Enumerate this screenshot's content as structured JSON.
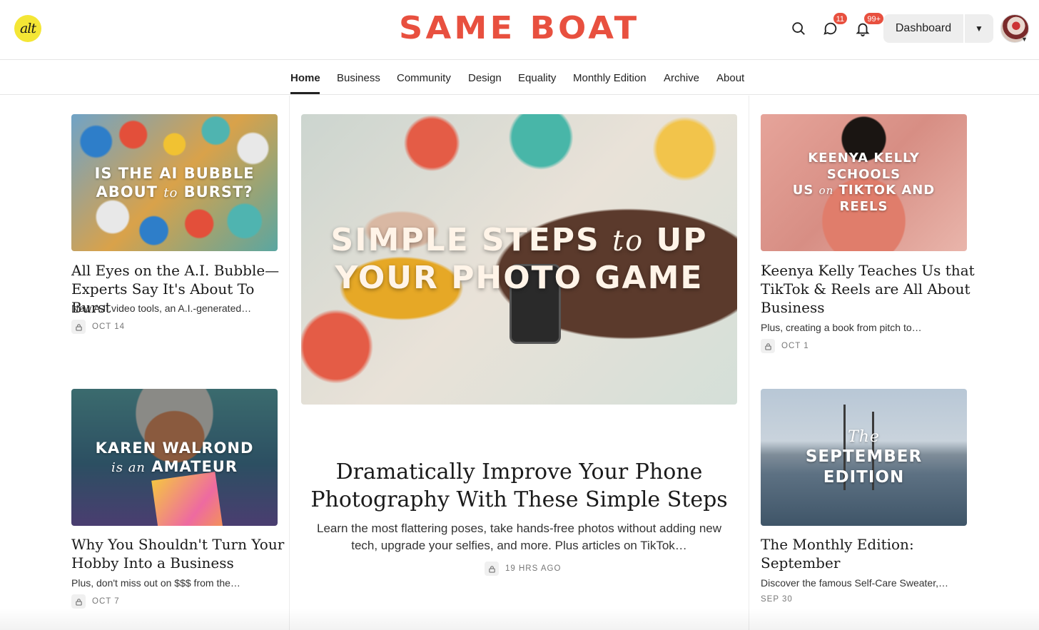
{
  "header": {
    "logo_text": "alt",
    "brand": "SAME BOAT",
    "messages_badge": "11",
    "notifications_badge": "99+",
    "dashboard_label": "Dashboard",
    "icons": [
      "search-icon",
      "chat-icon",
      "bell-icon",
      "caret-down-icon"
    ],
    "accent_color": "#e8503f"
  },
  "nav": {
    "items": [
      "Home",
      "Business",
      "Community",
      "Design",
      "Equality",
      "Monthly Edition",
      "Archive",
      "About"
    ],
    "active": "Home"
  },
  "feature": {
    "image_text_line1a": "SIMPLE STEPS",
    "image_text_line1b": "to",
    "image_text_line1c": "UP",
    "image_text_line2": "YOUR PHOTO GAME",
    "title": "Dramatically Improve Your Phone Photography With These Simple Steps",
    "subtitle": "Learn the most flattering poses, take hands-free photos without adding new tech, upgrade your selfies, and more. Plus articles on TikTok…",
    "meta": "19 HRS AGO"
  },
  "posts": [
    {
      "image_line1": "IS THE AI BUBBLE",
      "image_line2a": "ABOUT",
      "image_line2b": "to",
      "image_line2c": "BURST?",
      "title": "All Eyes on the A.I. Bubble—Experts Say It's About To Burst",
      "subtitle": "New A.I. video tools, an A.I.-generated…",
      "meta": "OCT 14"
    },
    {
      "image_line1": "KAREN WALROND",
      "image_line2a": "is an",
      "image_line2b": "AMATEUR",
      "title": "Why You Shouldn't Turn Your Hobby Into a Business",
      "subtitle": "Plus, don't miss out on $$$ from the…",
      "meta": "OCT 7"
    },
    {
      "image_line1": "KEENYA KELLY SCHOOLS",
      "image_line2a": "US",
      "image_line2b": "on",
      "image_line2c": "TIKTOK AND REELS",
      "title": "Keenya Kelly Teaches Us that TikTok & Reels are All About Business",
      "subtitle": "Plus, creating a book from pitch to…",
      "meta": "OCT 1"
    },
    {
      "image_line1": "The",
      "image_line2a": "SEPTEMBER",
      "image_line2b": "EDITION",
      "title": "The Monthly Edition: September",
      "subtitle": "Discover the famous Self-Care Sweater,…",
      "meta": "SEP 30"
    }
  ]
}
